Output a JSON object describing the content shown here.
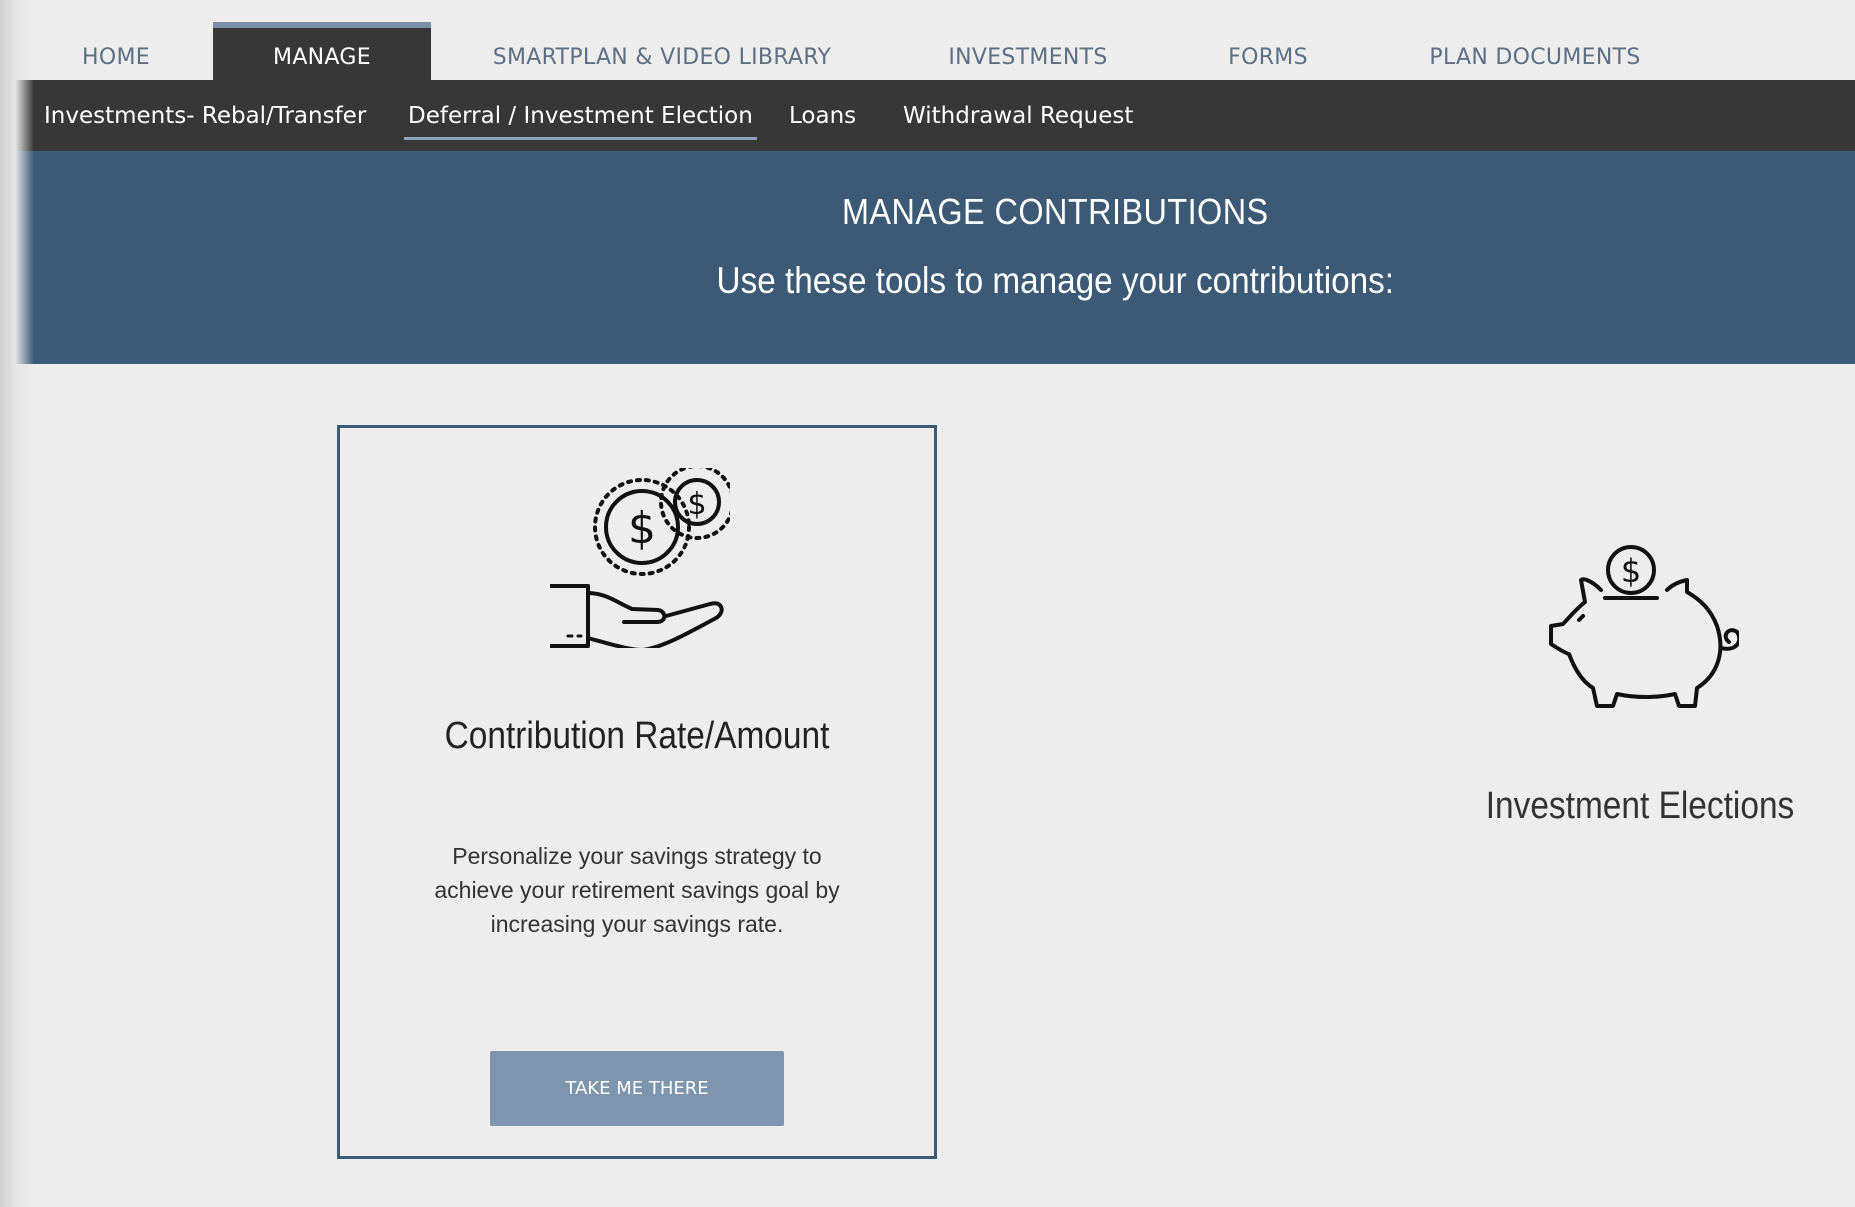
{
  "top_nav": {
    "tabs": [
      {
        "label": "HOME",
        "active": false
      },
      {
        "label": "MANAGE",
        "active": true
      },
      {
        "label": "SMARTPLAN & VIDEO LIBRARY",
        "active": false
      },
      {
        "label": "INVESTMENTS",
        "active": false
      },
      {
        "label": "FORMS",
        "active": false
      },
      {
        "label": "PLAN DOCUMENTS",
        "active": false
      }
    ]
  },
  "sub_nav": {
    "items": [
      {
        "label": "Investments- Rebal/Transfer",
        "active": false
      },
      {
        "label": "Deferral / Investment Election",
        "active": true
      },
      {
        "label": "Loans",
        "active": false
      },
      {
        "label": "Withdrawal Request",
        "active": false
      }
    ]
  },
  "hero": {
    "title": "MANAGE CONTRIBUTIONS",
    "subtitle": "Use these tools to manage your contributions:"
  },
  "cards": [
    {
      "icon": "hand-coins-icon",
      "title": "Contribution Rate/Amount",
      "description": "Personalize your savings strategy to achieve your retirement savings goal by increasing your savings rate.",
      "button_label": "TAKE ME THERE"
    },
    {
      "icon": "piggy-bank-icon",
      "title": "Investment Elections"
    }
  ],
  "colors": {
    "page_background": "#ededed",
    "nav_dark": "#373737",
    "hero_blue": "#3c5976",
    "button_blue": "#7f94ad",
    "tab_accent": "#7b8fa6",
    "tab_text": "#5c6f84"
  }
}
